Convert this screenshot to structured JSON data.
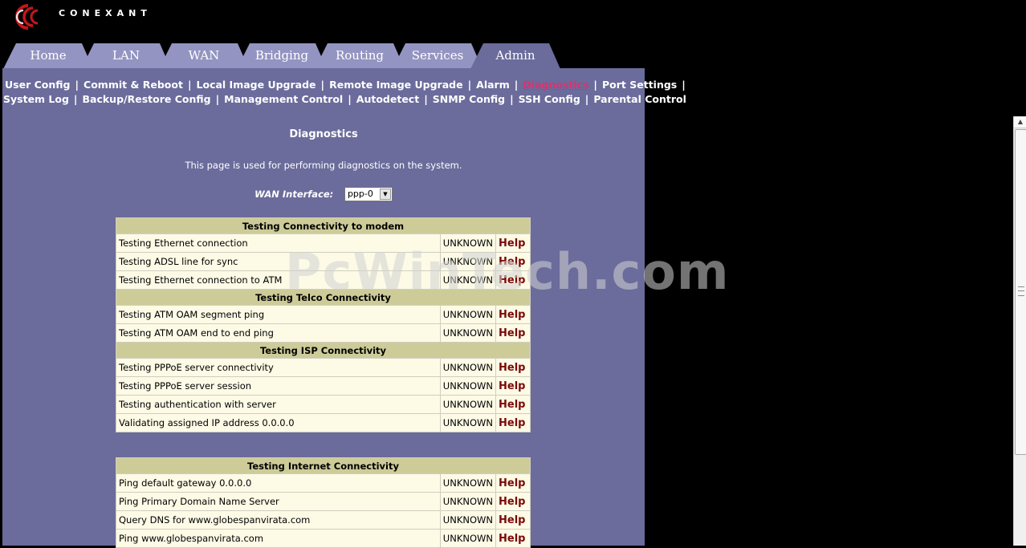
{
  "brand": {
    "name": "CONEXANT",
    "color": "#c4161c"
  },
  "tabs": [
    {
      "label": "Home"
    },
    {
      "label": "LAN"
    },
    {
      "label": "WAN"
    },
    {
      "label": "Bridging"
    },
    {
      "label": "Routing"
    },
    {
      "label": "Services"
    },
    {
      "label": "Admin",
      "active": true
    }
  ],
  "submenu": {
    "row1": [
      "User Config",
      "Commit & Reboot",
      "Local Image Upgrade",
      "Remote Image Upgrade",
      "Alarm",
      "Diagnostics",
      "Port Settings"
    ],
    "row2": [
      "System Log",
      "Backup/Restore Config",
      "Management Control",
      "Autodetect",
      "SNMP Config",
      "SSH Config",
      "Parental Control"
    ],
    "active": "Diagnostics"
  },
  "page": {
    "title": "Diagnostics",
    "description": "This page is used for performing diagnostics on the system.",
    "wan_label": "WAN Interface:",
    "wan_value": "ppp-0"
  },
  "tables": [
    {
      "sections": [
        {
          "title": "Testing Connectivity to modem",
          "rows": [
            {
              "test": "Testing Ethernet connection",
              "status": "UNKNOWN",
              "help": "Help"
            },
            {
              "test": "Testing ADSL line for sync",
              "status": "UNKNOWN",
              "help": "Help"
            },
            {
              "test": "Testing Ethernet connection to ATM",
              "status": "UNKNOWN",
              "help": "Help"
            }
          ]
        },
        {
          "title": "Testing Telco Connectivity",
          "rows": [
            {
              "test": "Testing ATM OAM segment ping",
              "status": "UNKNOWN",
              "help": "Help"
            },
            {
              "test": "Testing ATM OAM end to end ping",
              "status": "UNKNOWN",
              "help": "Help"
            }
          ]
        },
        {
          "title": "Testing ISP Connectivity",
          "rows": [
            {
              "test": "Testing PPPoE server connectivity",
              "status": "UNKNOWN",
              "help": "Help"
            },
            {
              "test": "Testing PPPoE server session",
              "status": "UNKNOWN",
              "help": "Help"
            },
            {
              "test": "Testing authentication with server",
              "status": "UNKNOWN",
              "help": "Help"
            },
            {
              "test": "Validating assigned IP address 0.0.0.0",
              "status": "UNKNOWN",
              "help": "Help"
            }
          ]
        }
      ]
    },
    {
      "sections": [
        {
          "title": "Testing Internet Connectivity",
          "rows": [
            {
              "test": "Ping default gateway 0.0.0.0",
              "status": "UNKNOWN",
              "help": "Help"
            },
            {
              "test": "Ping Primary Domain Name Server",
              "status": "UNKNOWN",
              "help": "Help"
            },
            {
              "test": "Query DNS for www.globespanvirata.com",
              "status": "UNKNOWN",
              "help": "Help"
            },
            {
              "test": "Ping www.globespanvirata.com",
              "status": "UNKNOWN",
              "help": "Help"
            }
          ]
        }
      ]
    }
  ],
  "watermark": "PcWinTech.com"
}
